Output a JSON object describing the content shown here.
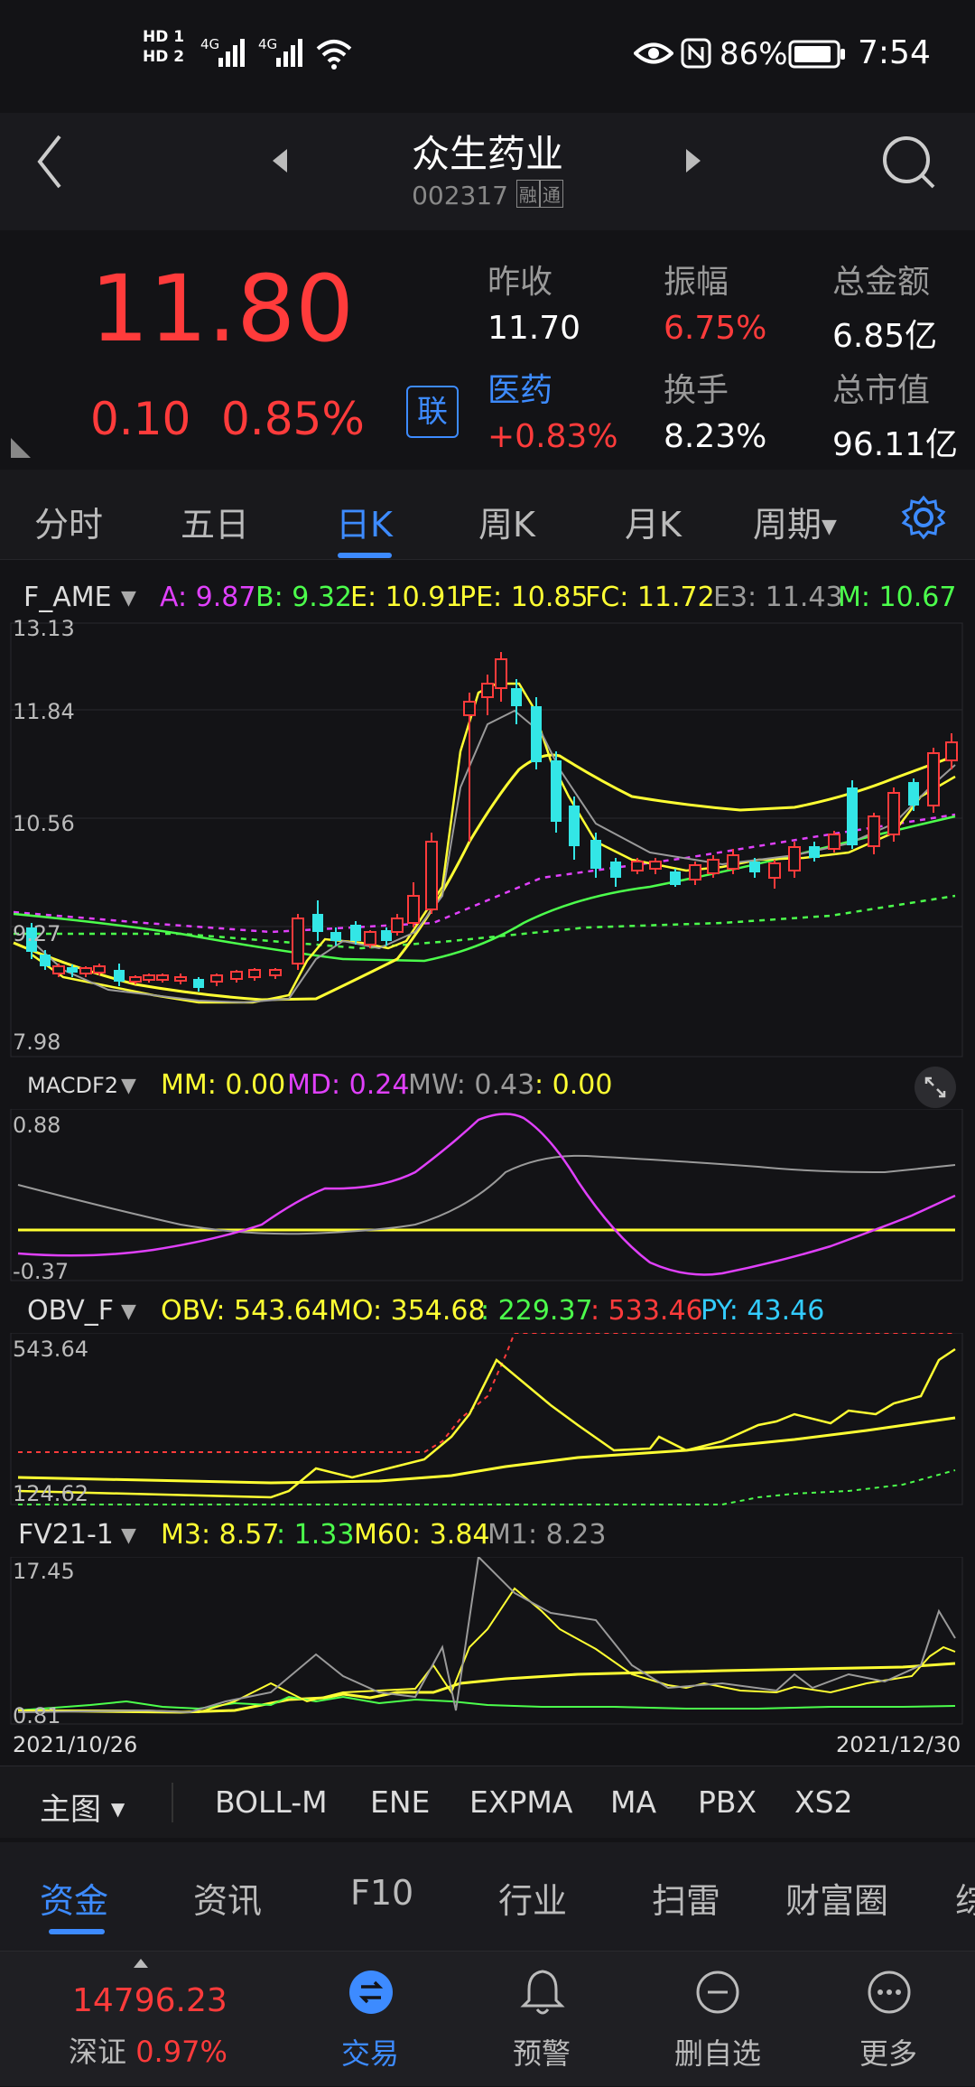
{
  "status": {
    "hd1": "HD 1",
    "hd2": "HD 2",
    "net1": "4G",
    "net2": "4G",
    "battery": "86%",
    "time": "7:54"
  },
  "header": {
    "title": "众生药业",
    "code": "002317",
    "badges": [
      "融",
      "通"
    ]
  },
  "quote": {
    "price": "11.80",
    "change": "0.10",
    "change_pct": "0.85%",
    "lian": "联",
    "stats": [
      {
        "label": "昨收",
        "value": "11.70",
        "value_color": "#ffffff"
      },
      {
        "label": "振幅",
        "value": "6.75%",
        "value_color": "#ff3b3b"
      },
      {
        "label": "总金额",
        "value": "6.85亿",
        "value_color": "#ffffff"
      },
      {
        "label": "医药",
        "value": "+0.83%",
        "value_color": "#ff3b3b"
      },
      {
        "label": "换手",
        "value": "8.23%",
        "value_color": "#ffffff"
      },
      {
        "label": "总市值",
        "value": "96.11亿",
        "value_color": "#ffffff"
      }
    ]
  },
  "tabs": [
    "分时",
    "五日",
    "日K",
    "周K",
    "月K",
    "周期"
  ],
  "active_tab": "日K",
  "main_chart": {
    "name": "F_AME",
    "legend": [
      {
        "text": "A: 9.87",
        "color": "#e040fb"
      },
      {
        "text": "B: 9.32",
        "color": "#4cff4c"
      },
      {
        "text": "E: 10.91",
        "color": "#ffff33"
      },
      {
        "text": "PE: 10.85",
        "color": "#ffff33"
      },
      {
        "text": "FC: 11.72",
        "color": "#ffff33"
      },
      {
        "text": "E3: 11.43",
        "color": "#9a9a9a"
      },
      {
        "text": "M: 10.67",
        "color": "#4cff4c"
      }
    ],
    "y_labels": [
      "13.13",
      "11.84",
      "10.56",
      "9.27",
      "7.98"
    ]
  },
  "macd": {
    "name": "MACDF2",
    "legend": [
      {
        "text": "MM: 0.00",
        "color": "#ffff33"
      },
      {
        "text": "MD: 0.24",
        "color": "#e040fb"
      },
      {
        "text": "MW: 0.43",
        "color": "#9a9a9a"
      },
      {
        "text": ": 0.00",
        "color": "#ffff33"
      }
    ],
    "y_labels": [
      "0.88",
      "-0.37"
    ]
  },
  "obv": {
    "name": "OBV_F",
    "legend": [
      {
        "text": "OBV: 543.64",
        "color": "#ffff33"
      },
      {
        "text": "MO: 354.68",
        "color": "#ffff33"
      },
      {
        "text": ": 229.37",
        "color": "#4cff4c"
      },
      {
        "text": ": 533.46",
        "color": "#ff3b3b"
      },
      {
        "text": "PY: 43.46",
        "color": "#33ccff"
      }
    ],
    "y_labels": [
      "543.64",
      "124.62"
    ]
  },
  "fv": {
    "name": "FV21-1",
    "legend": [
      {
        "text": "M3: 8.57",
        "color": "#ffff33"
      },
      {
        "text": ": 1.33",
        "color": "#4cff4c"
      },
      {
        "text": "M60: 3.84",
        "color": "#ffff33"
      },
      {
        "text": "M1: 8.23",
        "color": "#9a9a9a"
      }
    ],
    "y_labels": [
      "17.45",
      "0.81"
    ],
    "date_start": "2021/10/26",
    "date_end": "2021/12/30"
  },
  "indicator_bar": {
    "main": "主图",
    "items": [
      "BOLL-M",
      "ENE",
      "EXPMA",
      "MA",
      "PBX",
      "XS2"
    ]
  },
  "sub_tabs": [
    "资金",
    "资讯",
    "F10",
    "行业",
    "扫雷",
    "财富圈",
    "综"
  ],
  "active_sub_tab": "资金",
  "bottom_nav": {
    "index_value": "14796.23",
    "index_name": "深证",
    "index_pct": "0.97%",
    "items": [
      {
        "label": "交易",
        "icon": "exchange-icon",
        "active": true
      },
      {
        "label": "预警",
        "icon": "bell-icon",
        "active": false
      },
      {
        "label": "删自选",
        "icon": "minus-circle-icon",
        "active": false
      },
      {
        "label": "更多",
        "icon": "more-icon",
        "active": false
      }
    ]
  }
}
